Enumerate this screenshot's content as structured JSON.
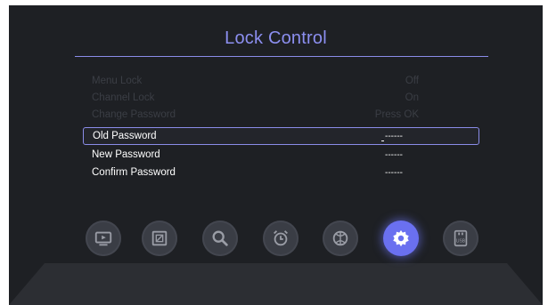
{
  "title": "Lock Control",
  "rows": [
    {
      "label": "Menu Lock",
      "value": "Off"
    },
    {
      "label": "Channel Lock",
      "value": "On"
    },
    {
      "label": "Change Password",
      "value": "Press OK"
    },
    {
      "label": "Old Password",
      "value": "------"
    },
    {
      "label": "New Password",
      "value": "------"
    },
    {
      "label": "Confirm Password",
      "value": "------"
    }
  ],
  "icons": [
    "media-player-icon",
    "picture-icon",
    "search-icon",
    "alarm-clock-icon",
    "ball-icon",
    "settings-gear-icon",
    "usb-icon"
  ],
  "icon_text": {
    "usb": "USB"
  },
  "colors": {
    "accent": "#6a70f0",
    "title": "#8c8ff0",
    "background": "#1e2024"
  }
}
